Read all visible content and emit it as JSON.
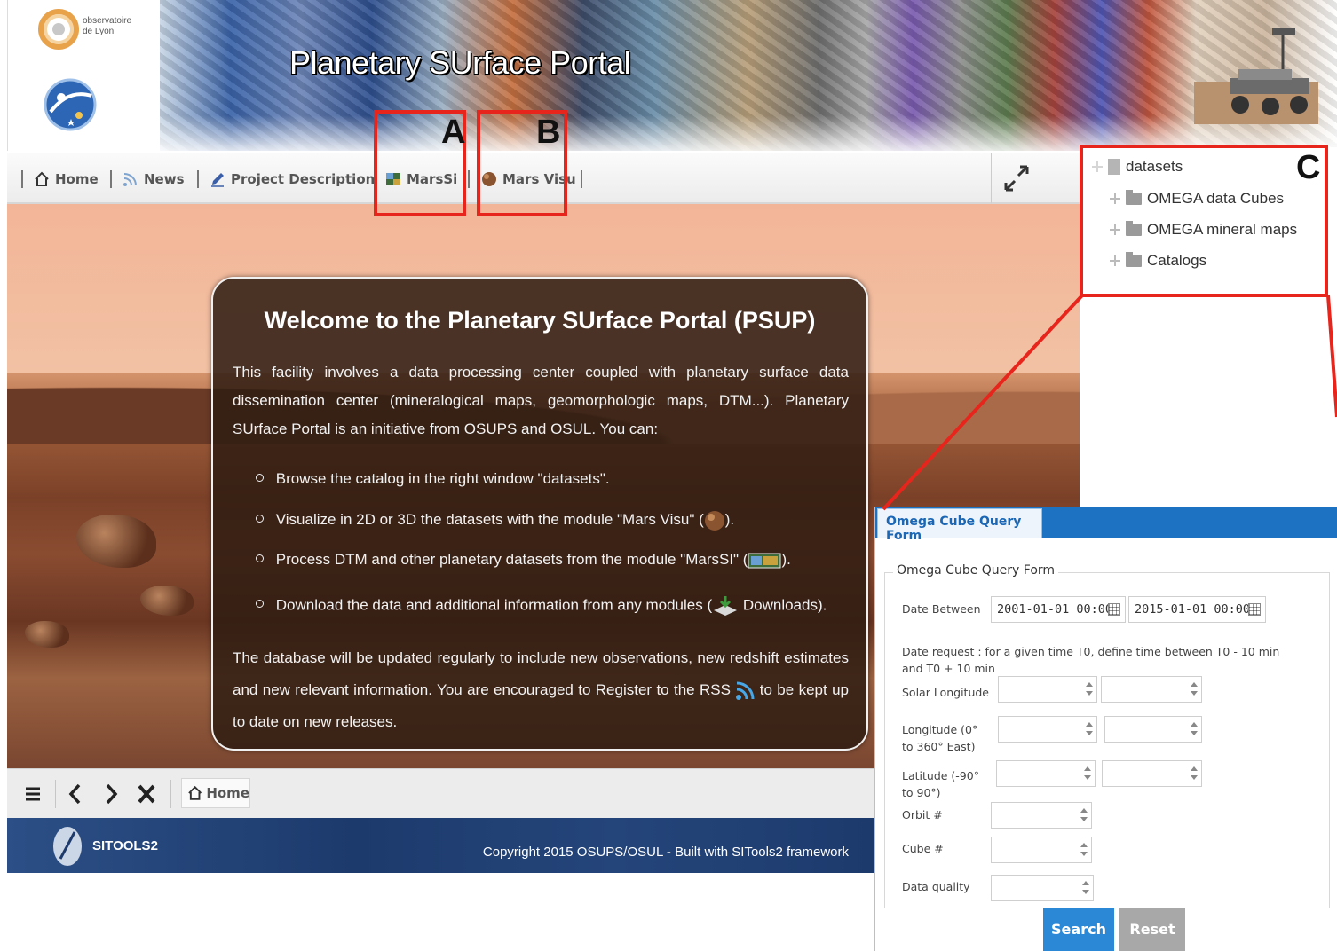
{
  "header": {
    "logo_text": "observatoire de Lyon",
    "title": "Planetary SUrface Portal"
  },
  "nav": {
    "items": [
      {
        "label": "Home",
        "icon": "home-icon"
      },
      {
        "label": "News",
        "icon": "rss-icon"
      },
      {
        "label": "Project Description",
        "icon": "pencil-icon"
      },
      {
        "label": "MarsSi",
        "icon": "map-thumbnail-icon"
      },
      {
        "label": "Mars Visu",
        "icon": "planet-icon"
      }
    ],
    "expand_icon": "expand-icon"
  },
  "welcome": {
    "title": "Welcome to the Planetary SUrface Portal (PSUP)",
    "intro": "This facility involves a data processing center coupled with planetary surface data dissemination center (mineralogical maps, geomorphologic maps, DTM...). Planetary SUrface Portal is an initiative from OSUPS and OSUL. You can:",
    "bullets": [
      {
        "before": "Browse the catalog in the right window \"datasets\".",
        "after": ""
      },
      {
        "before": "Visualize in 2D or 3D the datasets with the module \"Mars Visu\" (",
        "after": ")."
      },
      {
        "before": "Process DTM and other planetary datasets from the module \"MarsSI\" (",
        "after": ")."
      },
      {
        "before": "Download the data and additional information from any modules (",
        "after": " Downloads)."
      }
    ],
    "outro_before": "The database will be updated regularly to include new observations, new redshift estimates and new relevant information. You are encouraged to Register to the RSS ",
    "outro_after": " to be kept up to date on new releases."
  },
  "toolbar": {
    "home_label": "Home"
  },
  "footer": {
    "logo_text": "SITOOLS2",
    "copyright": "Copyright 2015 OSUPS/OSUL - Built with SITools2 framework"
  },
  "tree": {
    "root": "datasets",
    "children": [
      "OMEGA data Cubes",
      "OMEGA mineral maps",
      "Catalogs"
    ]
  },
  "query_form": {
    "tab": "Omega Cube Query Form",
    "legend": "Omega Cube Query Form",
    "date_label": "Date Between",
    "date_from": "2001-01-01 00:00",
    "date_to": "2015-01-01 00:00",
    "date_note": "Date request : for a given time T0, define time between T0 - 10 min and T0 + 10 min",
    "solar_longitude": "Solar Longitude",
    "longitude": "Longitude (0° to 360° East)",
    "latitude": "Latitude (-90° to 90°)",
    "orbit": "Orbit #",
    "cube": "Cube #",
    "data_quality": "Data quality",
    "search": "Search",
    "reset": "Reset",
    "colors": {
      "header": "#1d72c2",
      "search": "#2b88d6",
      "reset": "#a8a8a8"
    }
  },
  "annotations": {
    "a": "A",
    "b": "B",
    "c": "C",
    "color": "#e8251c"
  }
}
